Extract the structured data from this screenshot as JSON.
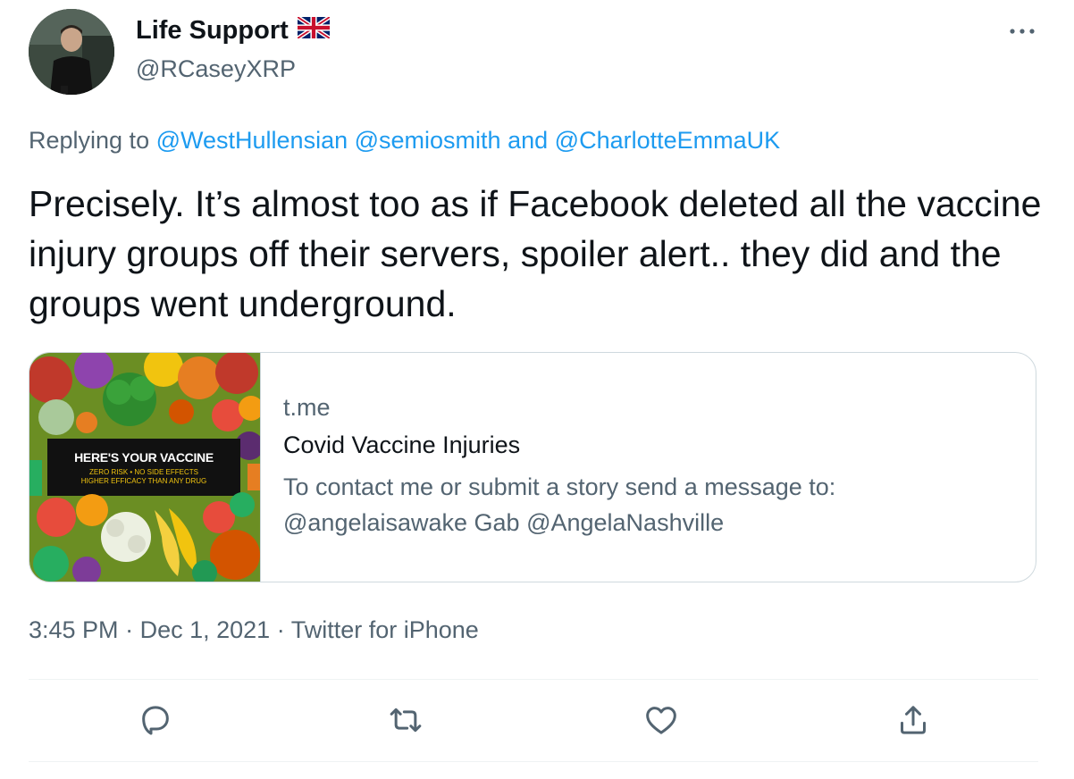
{
  "author": {
    "display_name": "Life Support",
    "handle": "@RCaseyXRP",
    "flag_icon": "uk-flag-icon"
  },
  "reply": {
    "prefix": "Replying to",
    "mentions": [
      "@WestHullensian",
      "@semiosmith"
    ],
    "conjunction": "and",
    "last_mention": "@CharlotteEmmaUK"
  },
  "tweet": {
    "text": "Precisely. It’s almost too as if Facebook deleted all the vaccine injury groups off their servers, spoiler alert.. they did and the groups went underground."
  },
  "card": {
    "image_banner": {
      "headline": "HERE'S YOUR VACCINE",
      "line1": "ZERO RISK • NO SIDE EFFECTS",
      "line2": "HIGHER EFFICACY THAN ANY DRUG"
    },
    "domain": "t.me",
    "title": "Covid Vaccine Injuries",
    "description_line1": "To contact me or submit a story send a message to:",
    "description_line2": "@angelaisawake Gab @AngelaNashville"
  },
  "meta": {
    "time": "3:45 PM",
    "date": "Dec 1, 2021",
    "source": "Twitter for iPhone",
    "separator": "·"
  },
  "actions": [
    "reply-icon",
    "retweet-icon",
    "like-icon",
    "share-icon"
  ],
  "colors": {
    "link": "#1d9bf0",
    "secondary_text": "#536471",
    "primary_text": "#0f1419",
    "border": "#cfd9de"
  }
}
